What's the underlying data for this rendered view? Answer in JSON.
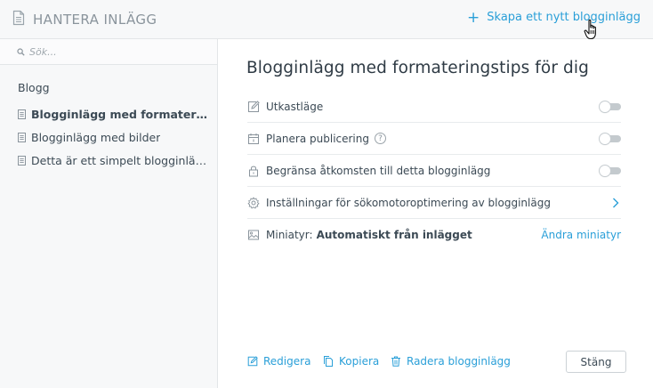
{
  "header": {
    "title": "HANTERA INLÄGG",
    "new_post_label": "Skapa ett nytt blogginlägg"
  },
  "sidebar": {
    "search_placeholder": "Sök...",
    "section_label": "Blogg",
    "items": [
      {
        "label": "Blogginlägg med formateringstips för dig",
        "active": true
      },
      {
        "label": "Blogginlägg med bilder",
        "active": false
      },
      {
        "label": "Detta är ett simpelt blogginlägg",
        "active": false
      }
    ]
  },
  "main": {
    "title": "Blogginlägg med formateringstips för dig",
    "draft_label": "Utkastläge",
    "draft_enabled": false,
    "schedule_label": "Planera publicering",
    "schedule_help": "?",
    "schedule_enabled": false,
    "restrict_label": "Begränsa åtkomsten till detta blogginlägg",
    "restrict_enabled": false,
    "seo_label": "Inställningar för sökomotoroptimering av blogginlägg",
    "thumbnail_label": "Miniatyr:",
    "thumbnail_value": "Automatiskt från inlägget",
    "thumbnail_change": "Ändra miniatyr"
  },
  "footer": {
    "edit_label": "Redigera",
    "copy_label": "Kopiera",
    "delete_label": "Radera blogginlägg",
    "close_label": "Stäng"
  },
  "colors": {
    "accent": "#2a9fd8",
    "panel": "#f7f8f9",
    "text": "#3c4a55"
  },
  "icons": [
    "document-icon",
    "plus-icon",
    "hand-cursor-icon",
    "search-icon",
    "post-icon",
    "edit-icon",
    "calendar-icon",
    "lock-icon",
    "gear-icon",
    "image-icon",
    "chevron-right-icon",
    "copy-icon",
    "trash-icon"
  ]
}
